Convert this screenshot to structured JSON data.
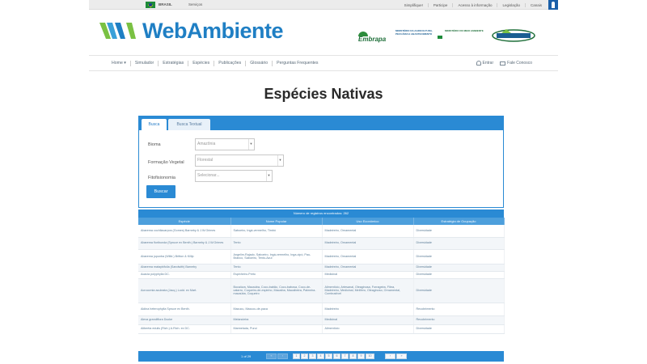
{
  "gov_bar": {
    "brasil": "BRASIL",
    "servicos": "Serviços",
    "links": [
      "Simplifique!",
      "Participe",
      "Acesso à informação",
      "Legislação",
      "Canais"
    ]
  },
  "header": {
    "logo_text": "WebAmbiente",
    "partner_embrapa": "Embrapa",
    "partner_mapa": "Ministério da Agricultura, Pecuária e Abastecimento",
    "partner_mma": "Ministério do Meio Ambiente"
  },
  "nav": {
    "items": [
      "Home ▾",
      "Simulador",
      "Estratégias",
      "Espécies",
      "Publicações",
      "Glossário",
      "Perguntas Frequentes"
    ],
    "entrar": "Entrar",
    "fale_conosco": "Fale Conosco"
  },
  "page": {
    "title": "Espécies Nativas"
  },
  "search": {
    "tabs": [
      "Busca",
      "Busca Textual"
    ],
    "fields": [
      {
        "label": "Bioma",
        "value": "Amazônia"
      },
      {
        "label": "Formação Vegetal",
        "value": "Florestal"
      },
      {
        "label": "Fitofisionomia",
        "value": "Selecionar..."
      }
    ],
    "button": "Buscar"
  },
  "results": {
    "summary": "Número de registros encontrados: 262",
    "columns": [
      "Espécie",
      "Nome Popular",
      "Uso Econômico",
      "Estratégia de Ocupação"
    ],
    "rows": [
      [
        "Abarema cochliacarpos (Gomes) Barneby & J.W.Grimes",
        "Saboeiro, Ingá-vermelho, Timbó",
        "Madeireiro, Ornamental",
        "Diversidade"
      ],
      [
        "Abarema floribunda (Spruce ex Benth.) Barneby & J.W.Grimes",
        "Tento",
        "Madeireiro, Ornamental",
        "Diversidade"
      ],
      [
        "Abarema jupunba (Willd.) Britton & Killip",
        "Angelim-Rajado, Saboeiro, Ingá-vermelho, Inga-cipó, Pau-Branco, Saboeiro, Tento-Azul",
        "Madeireiro, Ornamental",
        "Diversidade"
      ],
      [
        "Abarema mataybifolia (Sandwith) Barneby",
        "Tento",
        "Madeireiro, Ornamental",
        "Diversidade"
      ],
      [
        "Acacia polyphylla DC.",
        "Espinheiro-Preto",
        "Medicinal",
        "Diversidade"
      ],
      [
        "Acrocomia aculeata (Jacq.) Lodd. ex Mart.",
        "Bocaiúva, Macaúba, Coco-babão, Coco-babosa, Coco-de-catarro, Coqueiro-de-espinho, Macaíba, Macaibeira, Palmeira-macaúba, Coqueiro",
        "Alimentício, Artesanal, Oleaginosa, Forrageira, Fibra, Madeireiro, Medicinal, Melífero, Oleaginoso, Ornamental, Combustível",
        "Diversidade"
      ],
      [
        "Aldina heterophylla Spruce ex Benth.",
        "Macucu, Macucu-de-paca",
        "Madeireiro",
        "Recobrimento"
      ],
      [
        "Alexa grandiflora Ducke",
        "Melancieira",
        "Medicinal",
        "Recobrimento"
      ],
      [
        "Alibertia edulis (Rich.) A.Rich. ex DC.",
        "Marmelada, Puruí",
        "Alimentício",
        "Diversidade"
      ]
    ],
    "pager_info": "1 of 29",
    "pages": [
      "1",
      "2",
      "3",
      "4",
      "5",
      "6",
      "7",
      "8",
      "9",
      "10"
    ],
    "first": "«",
    "prev": "‹",
    "next": "›",
    "last": "»"
  },
  "colors": {
    "brand_blue": "#1f7fc4",
    "brand_green": "#7ac143",
    "panel_blue": "#2a8ad4"
  }
}
